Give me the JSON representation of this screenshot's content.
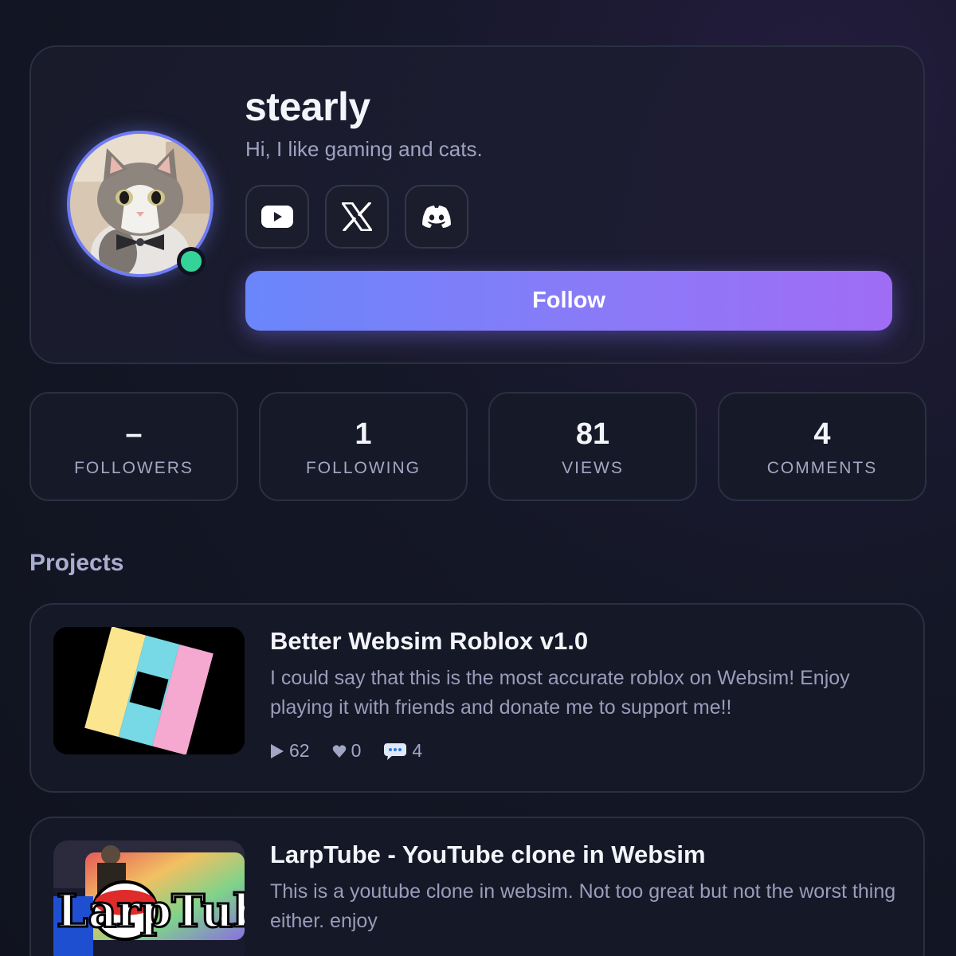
{
  "profile": {
    "username": "stearly",
    "bio": "Hi, I like gaming and cats.",
    "online": true,
    "socials": [
      {
        "name": "YouTube",
        "icon": "youtube-icon"
      },
      {
        "name": "X",
        "icon": "x-icon"
      },
      {
        "name": "Discord",
        "icon": "discord-icon"
      }
    ],
    "follow_label": "Follow"
  },
  "stats": [
    {
      "value": "–",
      "label": "FOLLOWERS"
    },
    {
      "value": "1",
      "label": "FOLLOWING"
    },
    {
      "value": "81",
      "label": "VIEWS"
    },
    {
      "value": "4",
      "label": "COMMENTS"
    }
  ],
  "projects_title": "Projects",
  "projects": [
    {
      "title": "Better Websim Roblox v1.0",
      "description": "I could say that this is the most accurate roblox on Websim! Enjoy playing it with friends and donate me to support me!!",
      "plays": "62",
      "likes": "0",
      "comments": "4"
    },
    {
      "title": "LarpTube - YouTube clone in Websim",
      "description": "This is a youtube clone in websim. Not too great but not the worst thing either. enjoy",
      "thumbnail_text": "LarpTube"
    }
  ],
  "colors": {
    "accent_start": "#6a86fb",
    "accent_end": "#a06cf6",
    "online": "#34d399",
    "avatar_ring": "#6f7cf6"
  }
}
